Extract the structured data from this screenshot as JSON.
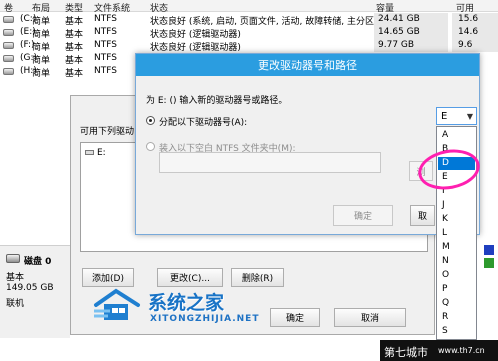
{
  "table": {
    "headers": [
      "卷",
      "布局",
      "类型",
      "文件系统",
      "状态",
      "容量",
      "可用"
    ],
    "rows": [
      {
        "vol": "(C:)",
        "layout": "简单",
        "type": "基本",
        "fs": "NTFS",
        "status": "状态良好 (系统, 启动, 页面文件, 活动, 故障转储, 主分区)",
        "capacity": "24.41 GB",
        "free": "15.6"
      },
      {
        "vol": "(E:)",
        "layout": "简单",
        "type": "基本",
        "fs": "NTFS",
        "status": "状态良好 (逻辑驱动器)",
        "capacity": "14.65 GB",
        "free": "14.6"
      },
      {
        "vol": "(F:)",
        "layout": "简单",
        "type": "基本",
        "fs": "NTFS",
        "status": "状态良好 (逻辑驱动器)",
        "capacity": "9.77 GB",
        "free": "9.6"
      },
      {
        "vol": "(G:)",
        "layout": "简单",
        "type": "基本",
        "fs": "NTFS",
        "status": "",
        "capacity": "",
        "free": ""
      },
      {
        "vol": "(H:)",
        "layout": "简单",
        "type": "基本",
        "fs": "NTFS",
        "status": "",
        "capacity": "",
        "free": ""
      }
    ]
  },
  "outer_dialog": {
    "label": "可用下列驱动",
    "list_item": "E:",
    "buttons": {
      "add": "添加(D)",
      "change": "更改(C)...",
      "delete": "删除(R)"
    }
  },
  "disk": {
    "name": "磁盘 0",
    "type": "基本",
    "size": "149.05 GB",
    "status": "联机"
  },
  "main_dialog": {
    "title": "更改驱动器号和路径",
    "prompt": "为 E: () 输入新的驱动器号或路径。",
    "radio_assign": "分配以下驱动器号(A):",
    "radio_mount": "装入以下空白 NTFS 文件夹中(M):",
    "browse_partial": "浏",
    "ok": "确定",
    "cancel_partial": "取"
  },
  "dropdown": {
    "value": "E",
    "options": [
      "A",
      "B",
      "D",
      "E",
      "I",
      "J",
      "K",
      "L",
      "M",
      "N",
      "O",
      "P",
      "Q",
      "R",
      "S"
    ],
    "selected_index": 2
  },
  "lower_buttons": {
    "ok": "确定",
    "cancel": "取消"
  },
  "watermark": {
    "title": "系统之家",
    "subtitle": "XITONGZHIJIA.NET"
  },
  "badge": {
    "name": "第七城市",
    "url": "www.th7.cn"
  },
  "colors": {
    "title_bar": "#2b9de0",
    "selection": "#0078d7",
    "highlight_circle": "#ff1fb0"
  }
}
